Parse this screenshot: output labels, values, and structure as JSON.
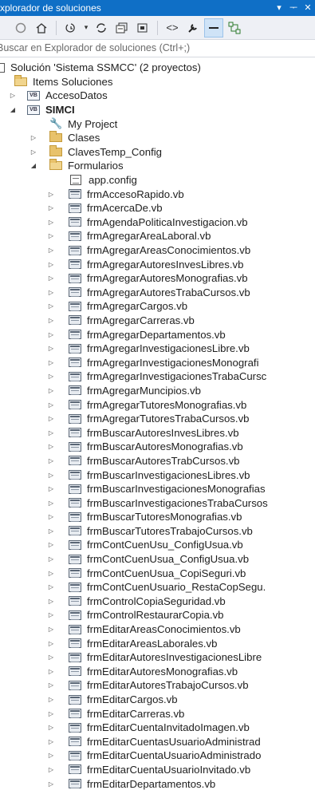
{
  "window": {
    "title": "Explorador de soluciones",
    "pin_glyph": "▾ ⊥",
    "close_glyph": "✕"
  },
  "toolbar": {
    "buttons": [
      "back-icon",
      "home-icon",
      "history-icon",
      "refresh-icon",
      "collapse-all-icon",
      "copy-icon",
      "code-icon",
      "properties-wrench-icon",
      "active-item-icon",
      "class-diagram-icon"
    ]
  },
  "search": {
    "placeholder": "Buscar en Explorador de soluciones (Ctrl+;)"
  },
  "tree": {
    "solution": "Solución 'Sistema SSMCC'  (2 proyectos)",
    "items_folder": "Items Soluciones",
    "project_acceso": "AccesoDatos",
    "project_simci": "SIMCI",
    "my_project": "My Project",
    "clases": "Clases",
    "claves": "ClavesTemp_Config",
    "formularios": "Formularios",
    "app_config": "app.config",
    "forms": [
      "frmAccesoRapido.vb",
      "frmAcercaDe.vb",
      "frmAgendaPoliticaInvestigacion.vb",
      "frmAgregarAreaLaboral.vb",
      "frmAgregarAreasConocimientos.vb",
      "frmAgregarAutoresInvesLibres.vb",
      "frmAgregarAutoresMonografias.vb",
      "frmAgregarAutoresTrabaCursos.vb",
      "frmAgregarCargos.vb",
      "frmAgregarCarreras.vb",
      "frmAgregarDepartamentos.vb",
      "frmAgregarInvestigacionesLibre.vb",
      "frmAgregarInvestigacionesMonografi",
      "frmAgregarInvestigacionesTrabaCursc",
      "frmAgregarMuncipios.vb",
      "frmAgregarTutoresMonografias.vb",
      "frmAgregarTutoresTrabaCursos.vb",
      "frmBuscarAutoresInvesLibres.vb",
      "frmBuscarAutoresMonografias.vb",
      "frmBuscarAutoresTrabCursos.vb",
      "frmBuscarInvestigacionesLibres.vb",
      "frmBuscarInvestigacionesMonografias",
      "frmBuscarInvestigacionesTrabaCursos",
      "frmBuscarTutoresMonografias.vb",
      "frmBuscarTutoresTrabajoCursos.vb",
      "frmContCuenUsu_ConfigUsua.vb",
      "frmContCuenUsua_ConfigUsua.vb",
      "frmContCuenUsua_CopiSeguri.vb",
      "frmContCuenUsuario_RestaCopSegu.",
      "frmControlCopiaSeguridad.vb",
      "frmControlRestaurarCopia.vb",
      "frmEditarAreasConocimientos.vb",
      "frmEditarAreasLaborales.vb",
      "frmEditarAutoresInvestigacionesLibre",
      "frmEditarAutoresMonografias.vb",
      "frmEditarAutoresTrabajoCursos.vb",
      "frmEditarCargos.vb",
      "frmEditarCarreras.vb",
      "frmEditarCuentaInvitadoImagen.vb",
      "frmEditarCuentasUsuarioAdministrad",
      "frmEditarCuentaUsuarioAdministrado",
      "frmEditarCuentaUsuarioInvitado.vb",
      "frmEditarDepartamentos.vb"
    ]
  }
}
